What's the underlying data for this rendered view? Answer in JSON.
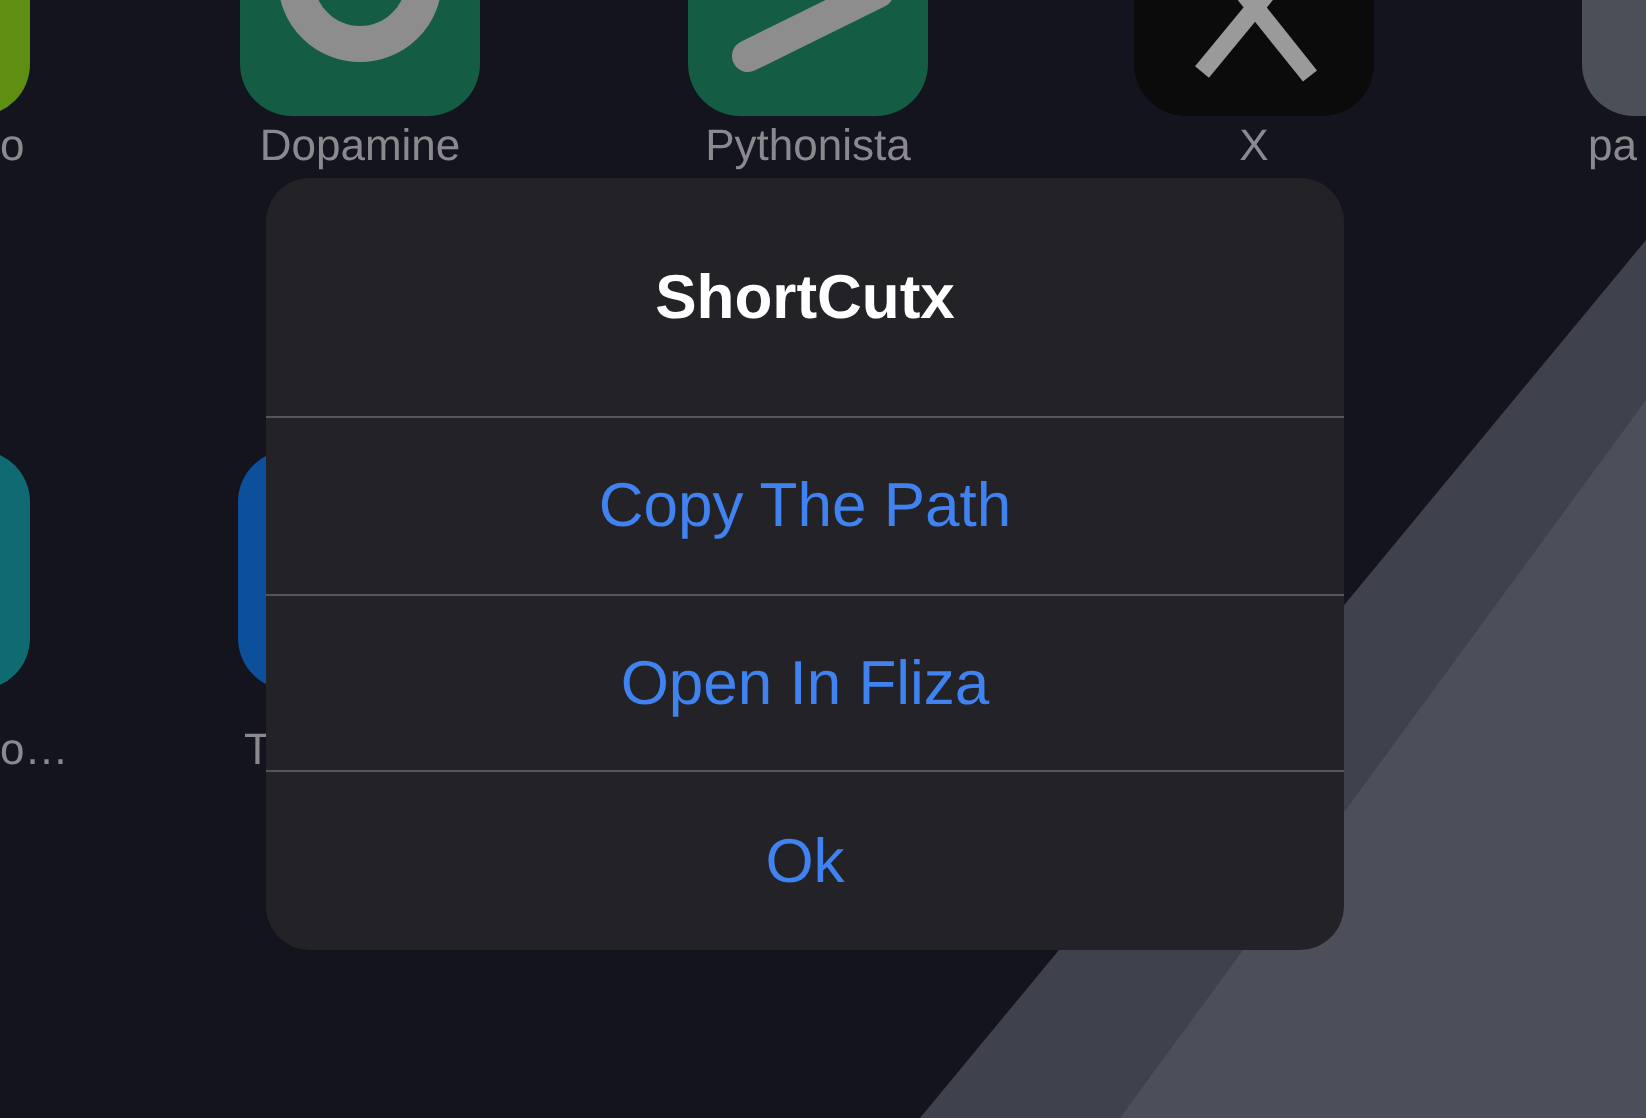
{
  "apps": [
    {
      "label": "o",
      "kind": "lime"
    },
    {
      "label": "Dopamine",
      "kind": "ring"
    },
    {
      "label": "Pythonista",
      "kind": "slash"
    },
    {
      "label": "X",
      "kind": "cross"
    },
    {
      "label": "pa",
      "kind": "gray"
    },
    {
      "label": "o…",
      "kind": "teal"
    },
    {
      "label": "T",
      "kind": "blue"
    }
  ],
  "alert": {
    "title": "ShortCutx",
    "actions": [
      "Copy The Path",
      "Open In Fliza",
      "Ok"
    ]
  }
}
